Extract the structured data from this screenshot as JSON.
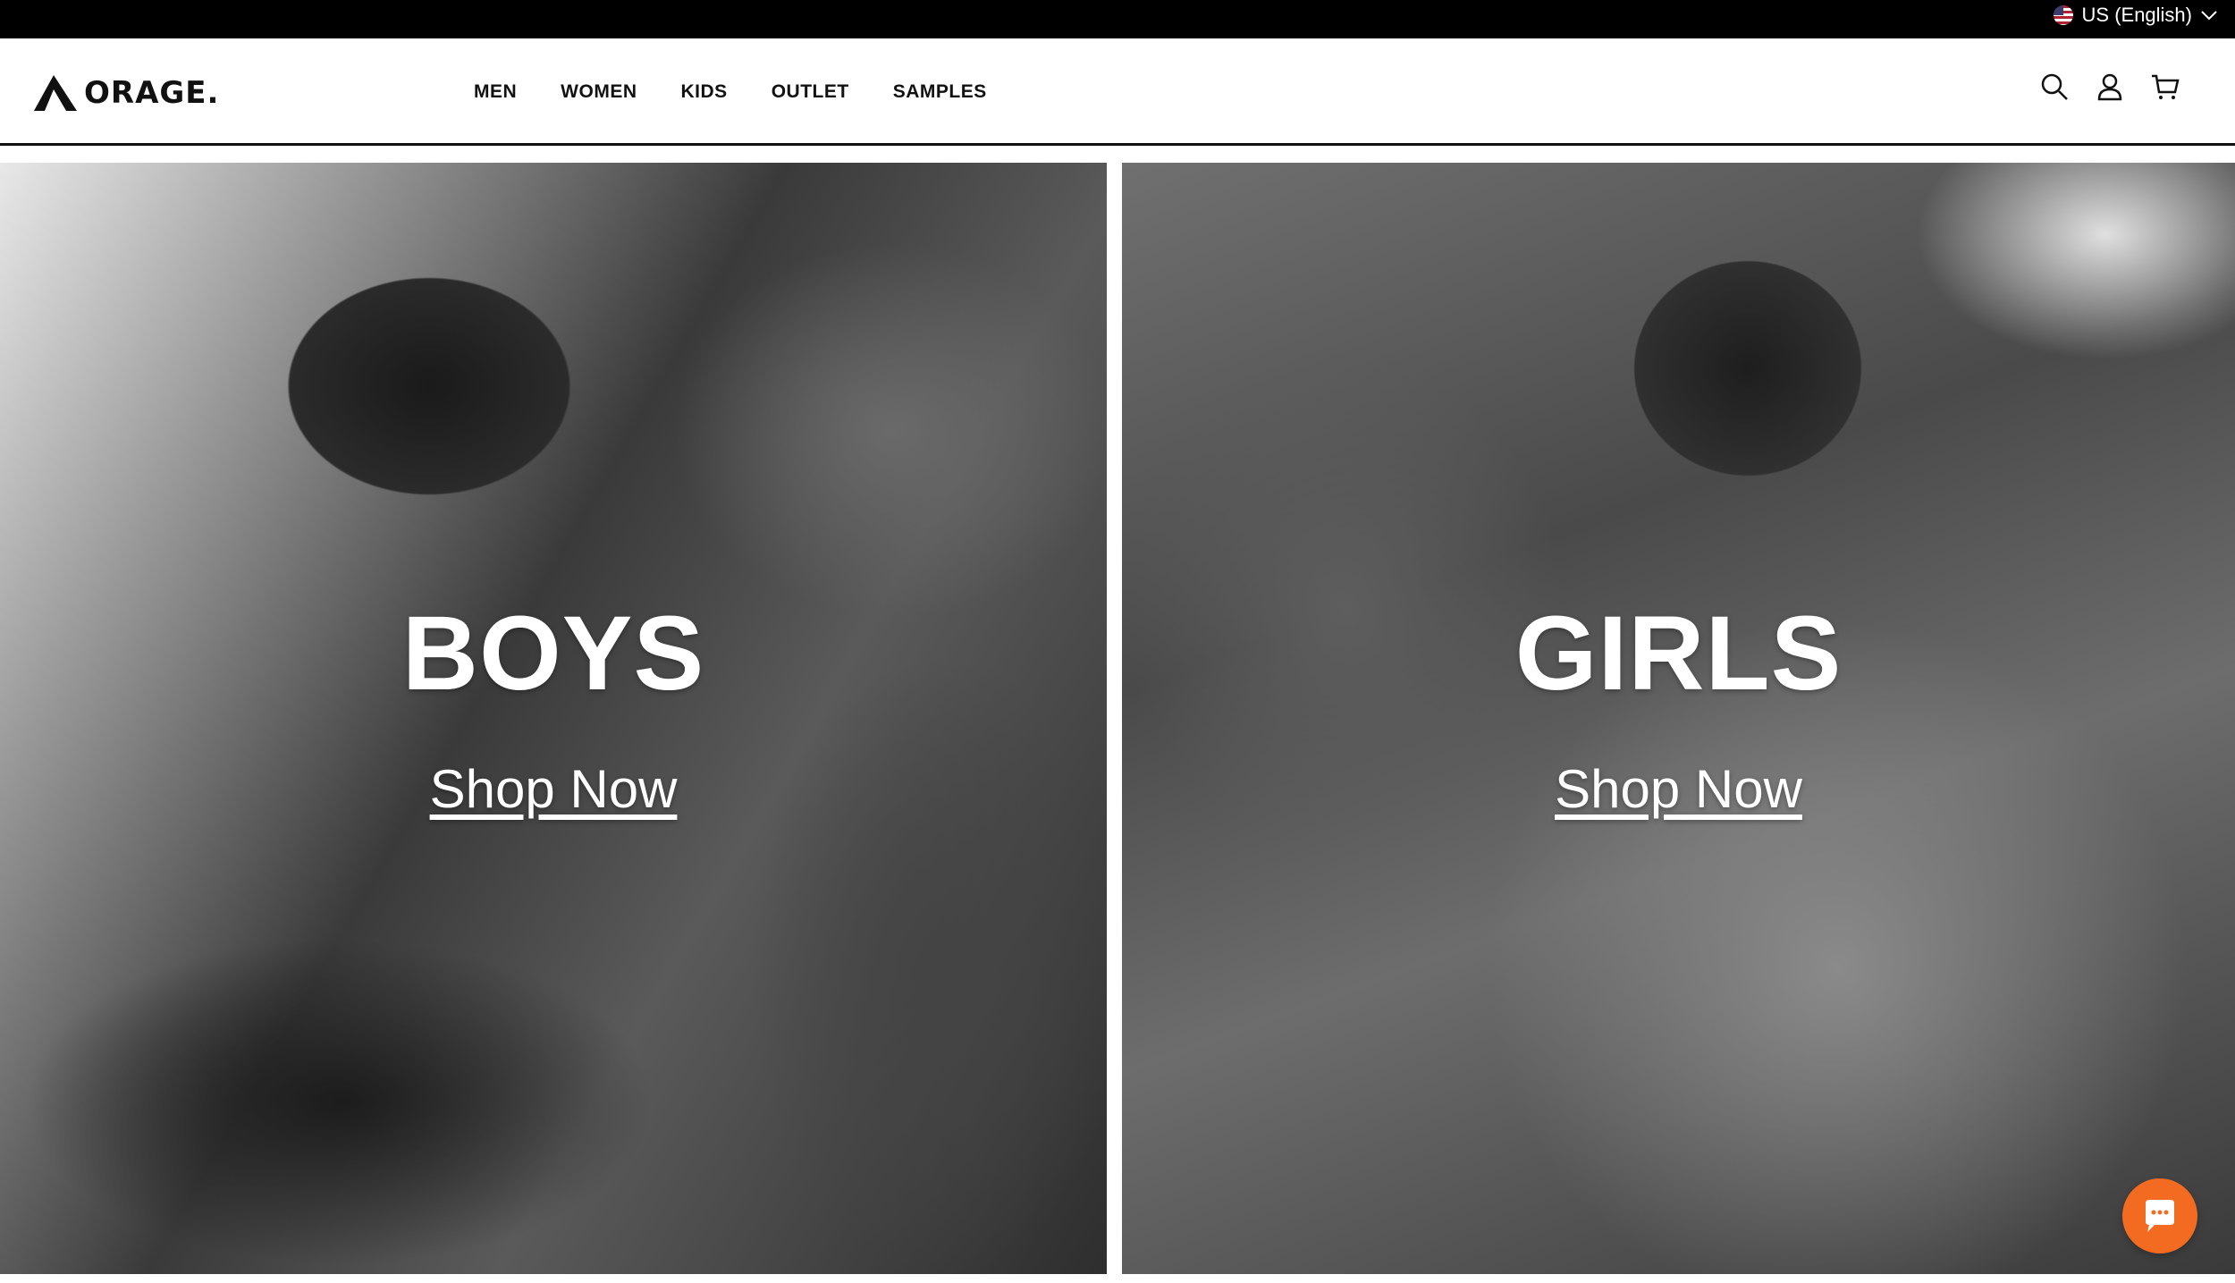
{
  "topbar": {
    "locale_label": "US (English)",
    "locale_icon": "us-flag-icon"
  },
  "header": {
    "logo_text": "ORAGE.",
    "nav": [
      {
        "label": "MEN"
      },
      {
        "label": "WOMEN"
      },
      {
        "label": "KIDS"
      },
      {
        "label": "OUTLET"
      },
      {
        "label": "SAMPLES"
      }
    ],
    "icons": [
      "search-icon",
      "account-icon",
      "cart-icon"
    ]
  },
  "panels": [
    {
      "title": "BOYS",
      "link": "Shop Now"
    },
    {
      "title": "GIRLS",
      "link": "Shop Now"
    }
  ],
  "chat": {
    "icon": "chat-bubble-icon",
    "color": "#f26b21"
  }
}
